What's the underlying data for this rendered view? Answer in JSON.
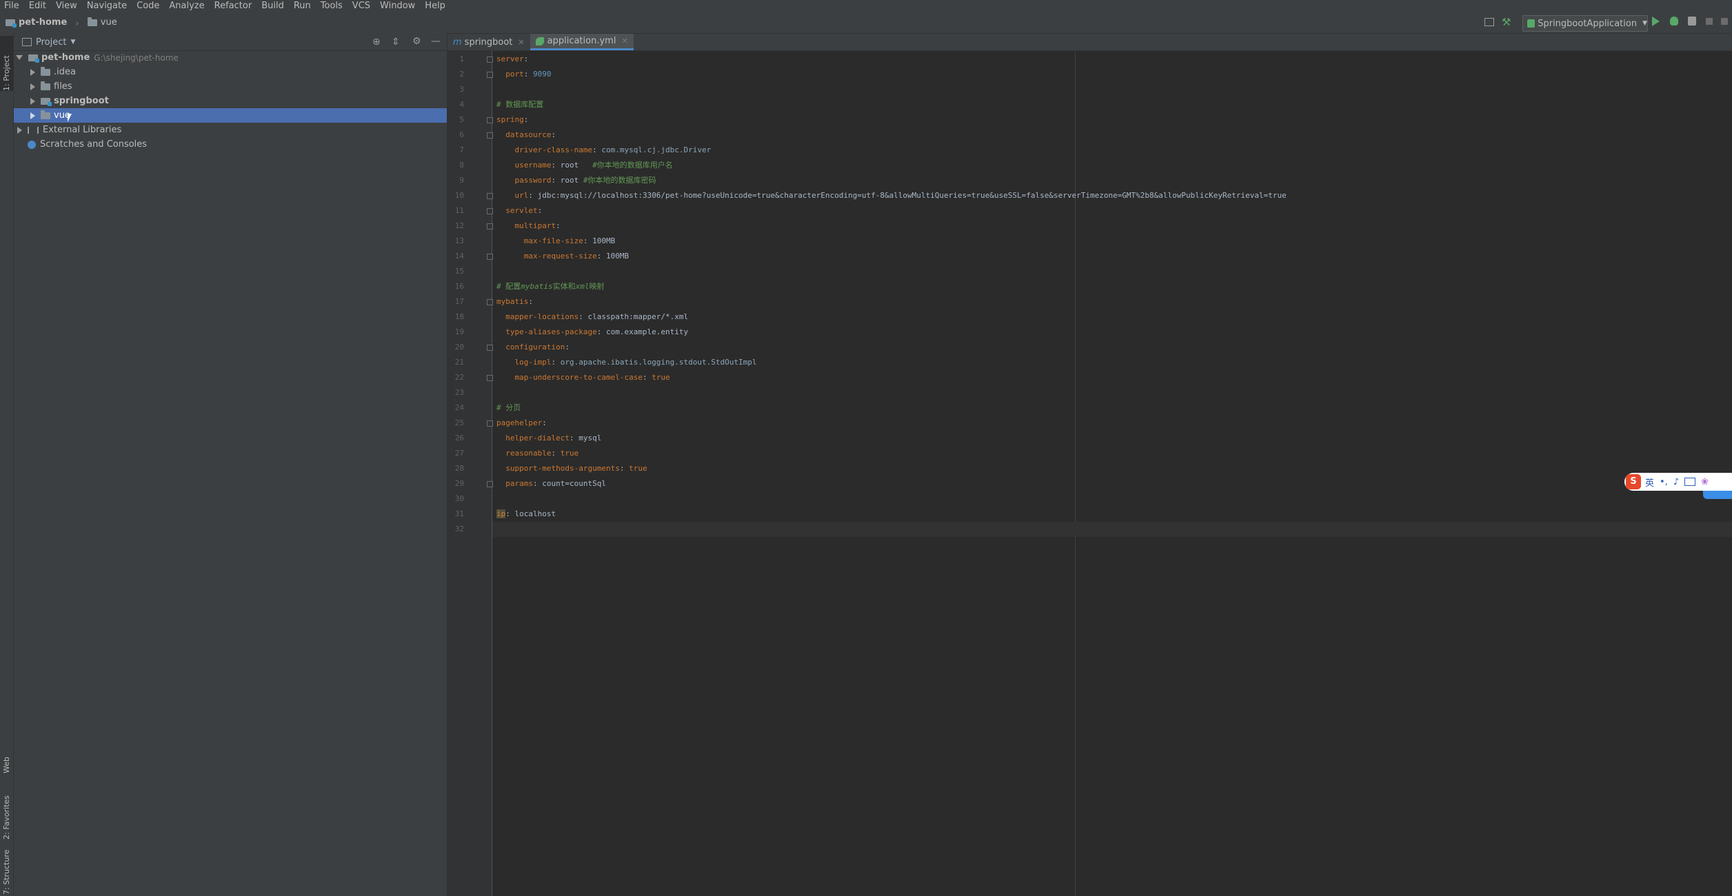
{
  "menu": [
    "File",
    "Edit",
    "View",
    "Navigate",
    "Code",
    "Analyze",
    "Refactor",
    "Build",
    "Run",
    "Tools",
    "VCS",
    "Window",
    "Help"
  ],
  "breadcrumb": {
    "project": "pet-home",
    "folder": "vue"
  },
  "run_config": {
    "label": "SpringbootApplication"
  },
  "left_strip": {
    "project_tab": "1: Project",
    "web_tab": "Web",
    "favorites_tab": "2: Favorites",
    "structure_tab": "7: Structure"
  },
  "project_panel": {
    "title": "Project",
    "root": {
      "name": "pet-home",
      "path": "G:\\shejing\\pet-home"
    },
    "items": [
      {
        "name": ".idea"
      },
      {
        "name": "files"
      },
      {
        "name": "springboot"
      },
      {
        "name": "vue"
      }
    ],
    "external_libraries": "External Libraries",
    "scratches": "Scratches and Consoles"
  },
  "tabs": [
    {
      "label": "springboot",
      "prefix": "m",
      "active": false
    },
    {
      "label": "application.yml",
      "active": true
    }
  ],
  "line_numbers": [
    "1",
    "2",
    "3",
    "4",
    "5",
    "6",
    "7",
    "8",
    "9",
    "10",
    "11",
    "12",
    "13",
    "14",
    "15",
    "16",
    "17",
    "18",
    "19",
    "20",
    "21",
    "22",
    "23",
    "24",
    "25",
    "26",
    "27",
    "28",
    "29",
    "30",
    "31",
    "32"
  ],
  "code": {
    "l1_key": "server",
    "l2_key": "port",
    "l2_val": "9090",
    "l4_comment": "# 数据库配置",
    "l5_key": "spring",
    "l6_key": "datasource",
    "l7_key": "driver-class-name",
    "l7_val": "com.mysql.cj.jdbc.Driver",
    "l8_key": "username",
    "l8_val": "root",
    "l8_comment": "#你本地的数据库用户名",
    "l9_key": "password",
    "l9_val": "root",
    "l9_comment": "#你本地的数据库密码",
    "l10_key": "url",
    "l10_val": "jdbc:mysql://localhost:3306/pet-home?useUnicode=true&characterEncoding=utf-8&allowMultiQueries=true&useSSL=false&serverTimezone=GMT%2b8&allowPublicKeyRetrieval=true",
    "l11_key": "servlet",
    "l12_key": "multipart",
    "l13_key": "max-file-size",
    "l13_val": "100MB",
    "l14_key": "max-request-size",
    "l14_val": "100MB",
    "l16_comment_a": "# 配置",
    "l16_comment_b": "mybatis",
    "l16_comment_c": "实体和",
    "l16_comment_d": "xml",
    "l16_comment_e": "映射",
    "l17_key": "mybatis",
    "l18_key": "mapper-locations",
    "l18_val": "classpath:mapper/*.xml",
    "l19_key": "type-aliases-package",
    "l19_val": "com.example.entity",
    "l20_key": "configuration",
    "l21_key": "log-impl",
    "l21_val": "org.apache.ibatis.logging.stdout.StdOutImpl",
    "l22_key": "map-underscore-to-camel-case",
    "l22_val": "true",
    "l24_comment": "# 分页",
    "l25_key": "pagehelper",
    "l26_key": "helper-dialect",
    "l26_val": "mysql",
    "l27_key": "reasonable",
    "l27_val": "true",
    "l28_key": "support-methods-arguments",
    "l28_val": "true",
    "l29_key": "params",
    "l29_val": "count=countSql",
    "l31_key": "ip",
    "l31_val": "localhost"
  },
  "ime": {
    "logo": "S",
    "lang": "英",
    "punct": "•,"
  }
}
